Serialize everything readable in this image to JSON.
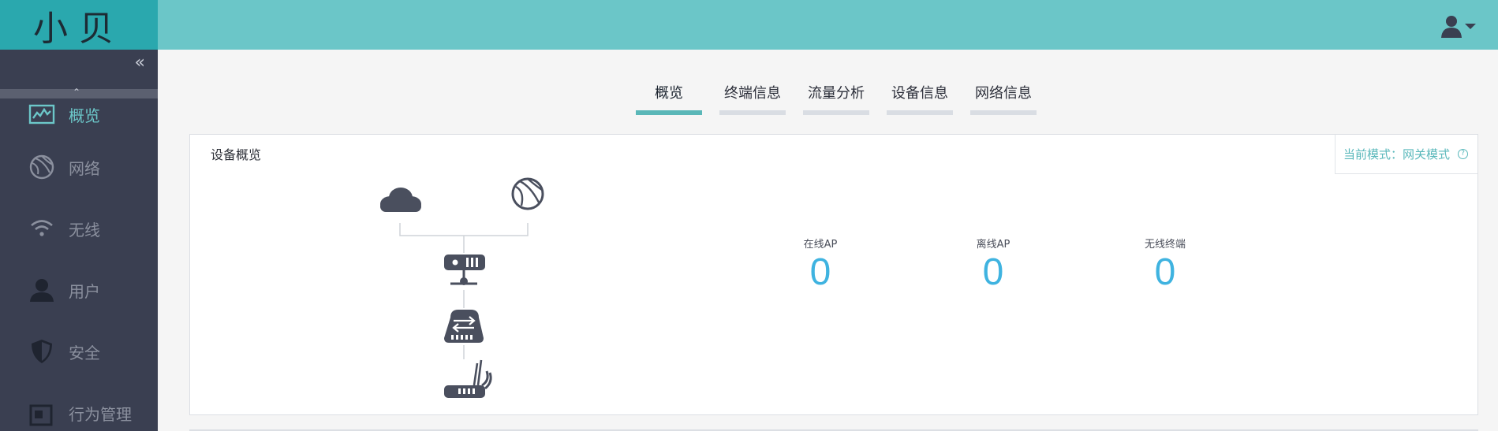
{
  "logo": {
    "text": "小贝"
  },
  "sidebar": {
    "collapse_glyph": "«",
    "scroll_up_glyph": "⌃",
    "items": [
      {
        "label": "概览",
        "icon": "monitor-chart-icon",
        "active": true
      },
      {
        "label": "网络",
        "icon": "globe-icon"
      },
      {
        "label": "无线",
        "icon": "wifi-icon"
      },
      {
        "label": "用户",
        "icon": "user-icon"
      },
      {
        "label": "安全",
        "icon": "shield-icon"
      },
      {
        "label": "行为管理",
        "icon": "behavior-icon"
      }
    ]
  },
  "tabs": [
    {
      "label": "概览",
      "active": true
    },
    {
      "label": "终端信息"
    },
    {
      "label": "流量分析"
    },
    {
      "label": "设备信息"
    },
    {
      "label": "网络信息"
    }
  ],
  "panel": {
    "title": "设备概览",
    "mode_text": "当前模式：网关模式",
    "help_glyph": "?"
  },
  "stats": [
    {
      "label": "在线AP",
      "value": "0"
    },
    {
      "label": "离线AP",
      "value": "0"
    },
    {
      "label": "无线终端",
      "value": "0"
    }
  ],
  "colors": {
    "sidebar_bg": "#3a3f51",
    "logo_bg": "#2aa8ae",
    "header_bg": "#6bc6c8",
    "accent": "#5ab7b8",
    "stat_value": "#3fb3e0"
  }
}
